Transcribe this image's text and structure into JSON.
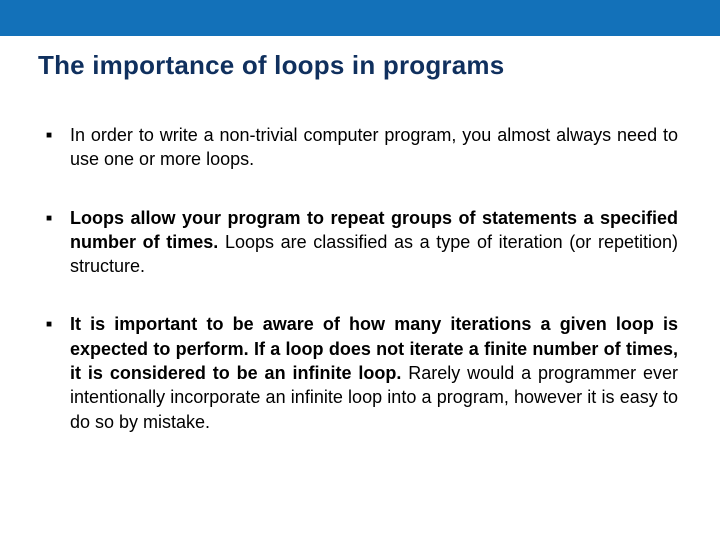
{
  "title": "The importance of loops in programs",
  "bullets": {
    "b1": {
      "text": "In order to write a non-trivial computer program, you almost always need to use one or more loops."
    },
    "b2": {
      "bold": "Loops allow your program to repeat groups of statements a specified number of times.",
      "rest": " Loops are classified as a type of iteration (or repetition) structure."
    },
    "b3": {
      "bold": "It is important to be aware of how many iterations a given loop is expected to perform. If a loop does not iterate a finite number of times, it is considered to be an infinite loop.",
      "rest": " Rarely would a programmer ever intentionally incorporate an infinite loop into a program, however it is easy to do so by mistake."
    }
  }
}
